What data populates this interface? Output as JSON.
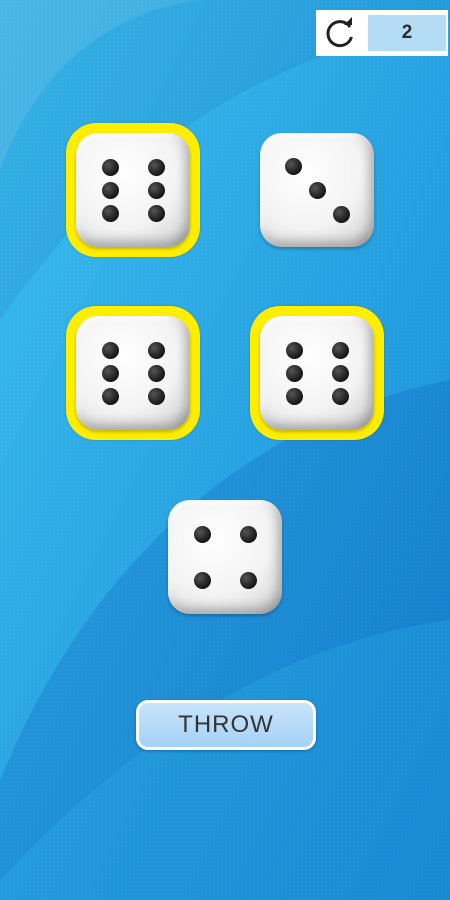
{
  "counter": {
    "value": "2",
    "icon": "refresh-icon"
  },
  "dice": [
    {
      "face": 6,
      "held": true
    },
    {
      "face": 3,
      "held": false
    },
    {
      "face": 6,
      "held": true
    },
    {
      "face": 6,
      "held": true
    },
    {
      "face": 4,
      "held": false
    }
  ],
  "throw_button": {
    "label": "THROW"
  },
  "colors": {
    "background": "#1fa6e4",
    "held_frame": "#ffee00",
    "button": "#b5dcf5"
  }
}
